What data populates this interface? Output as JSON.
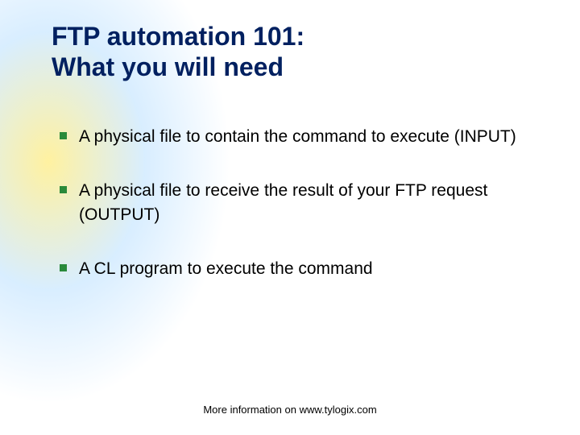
{
  "slide": {
    "title_line1": "FTP automation 101:",
    "title_line2": "What you will need",
    "bullets": [
      "A physical file to contain the command to execute (INPUT)",
      "A physical file to receive the result of your FTP request (OUTPUT)",
      "A CL program to execute the command"
    ],
    "footer": "More information on www.tylogix.com"
  }
}
